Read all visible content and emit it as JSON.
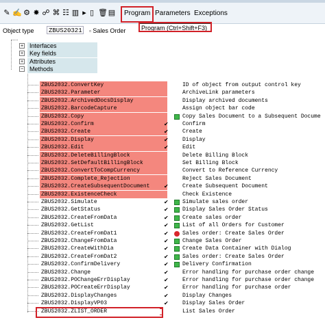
{
  "toolbar": {
    "menus": [
      "Program",
      "Parameters",
      "Exceptions"
    ],
    "tooltip": "Program   (Ctrl+Shift+F3)"
  },
  "object": {
    "label": "Object type",
    "value": "ZBUS20321",
    "description": "Sales Order"
  },
  "tree": {
    "nodes": [
      "Interfaces",
      "Key fields",
      "Attributes",
      "Methods"
    ]
  },
  "methods": [
    {
      "name": "ZBUS2032.ConvertKey",
      "desc": "ID of object from output control key",
      "color": "red",
      "check": false,
      "status": ""
    },
    {
      "name": "ZBUS2032.Parameter",
      "desc": "ArchiveLink parameters",
      "color": "red",
      "check": false,
      "status": ""
    },
    {
      "name": "ZBUS2032.ArchivedDocsDisplay",
      "desc": "Display archived documents",
      "color": "red",
      "check": false,
      "status": ""
    },
    {
      "name": "ZBUS2032.BarcodeCapture",
      "desc": "Assign object bar code",
      "color": "red",
      "check": false,
      "status": ""
    },
    {
      "name": "ZBUS2032.Copy",
      "desc": "Copy Sales Document to a Subsequent Docume",
      "color": "red",
      "check": false,
      "status": "green"
    },
    {
      "name": "ZBUS2032.Confirm",
      "desc": "Confirm",
      "color": "red",
      "check": true,
      "status": ""
    },
    {
      "name": "ZBUS2032.Create",
      "desc": "Create",
      "color": "red",
      "check": true,
      "status": ""
    },
    {
      "name": "ZBUS2032.Display",
      "desc": "Display",
      "color": "red",
      "check": true,
      "status": ""
    },
    {
      "name": "ZBUS2032.Edit",
      "desc": "Edit",
      "color": "red",
      "check": true,
      "status": ""
    },
    {
      "name": "ZBUS2032.DeleteBillingBlock",
      "desc": "Delete Billing Block",
      "color": "red",
      "check": false,
      "status": ""
    },
    {
      "name": "ZBUS2032.SetDefaultBillingBlock",
      "desc": "Set Billing Block",
      "color": "red",
      "check": false,
      "status": ""
    },
    {
      "name": "ZBUS2032.ConvertToCompCurrency",
      "desc": "Convert to Reference Currency",
      "color": "red",
      "check": false,
      "status": ""
    },
    {
      "name": "ZBUS2032.Complete_Rejection",
      "desc": "Reject Sales Document",
      "color": "red",
      "check": false,
      "status": ""
    },
    {
      "name": "ZBUS2032.CreateSubsequentDocument",
      "desc": "Create Subsequent Document",
      "color": "red",
      "check": true,
      "status": ""
    },
    {
      "name": "ZBUS2032.ExistenceCheck",
      "desc": "Check Existence",
      "color": "red",
      "check": false,
      "status": ""
    },
    {
      "name": "ZBUS2032.Simulate",
      "desc": "Simulate sales order",
      "color": "white",
      "check": true,
      "status": "green"
    },
    {
      "name": "ZBUS2032.GetStatus",
      "desc": "Display Sales Order Status",
      "color": "white",
      "check": true,
      "status": "green"
    },
    {
      "name": "ZBUS2032.CreateFromData",
      "desc": "Create sales order",
      "color": "white",
      "check": true,
      "status": "green"
    },
    {
      "name": "ZBUS2032.GetList",
      "desc": "List of all Orders for Customer",
      "color": "white",
      "check": true,
      "status": "green"
    },
    {
      "name": "ZBUS2032.CreateFromDat1",
      "desc": "Sales order: Create Sales Order",
      "color": "white",
      "check": true,
      "status": "stop"
    },
    {
      "name": "ZBUS2032.ChangeFromData",
      "desc": "Change Sales Order",
      "color": "white",
      "check": true,
      "status": "green"
    },
    {
      "name": "ZBUS2032.CreateWithDia",
      "desc": "Create Data Container with Dialog",
      "color": "white",
      "check": true,
      "status": "green"
    },
    {
      "name": "ZBUS2032.CreateFromDat2",
      "desc": "Sales order: Create Sales Order",
      "color": "white",
      "check": true,
      "status": "green"
    },
    {
      "name": "ZBUS2032.ConfirmDelivery",
      "desc": "Delivery Confirmation",
      "color": "white",
      "check": true,
      "status": "green"
    },
    {
      "name": "ZBUS2032.Change",
      "desc": "Error handling for purchase order change",
      "color": "white",
      "check": true,
      "status": ""
    },
    {
      "name": "ZBUS2032.POChangeErrDisplay",
      "desc": "Error handling for purchase order change",
      "color": "white",
      "check": true,
      "status": ""
    },
    {
      "name": "ZBUS2032.POCreateErrDisplay",
      "desc": "Error handling for purchase order",
      "color": "white",
      "check": true,
      "status": ""
    },
    {
      "name": "ZBUS2032.DisplayChanges",
      "desc": "Display Changes",
      "color": "white",
      "check": true,
      "status": ""
    },
    {
      "name": "ZBUS2032.DisplayVP03",
      "desc": "Display Sales Order",
      "color": "white",
      "check": true,
      "status": ""
    },
    {
      "name": "ZBUS2032.ZLIST_ORDER",
      "desc": "List Sales Order",
      "color": "white",
      "check": false,
      "status": ""
    }
  ]
}
